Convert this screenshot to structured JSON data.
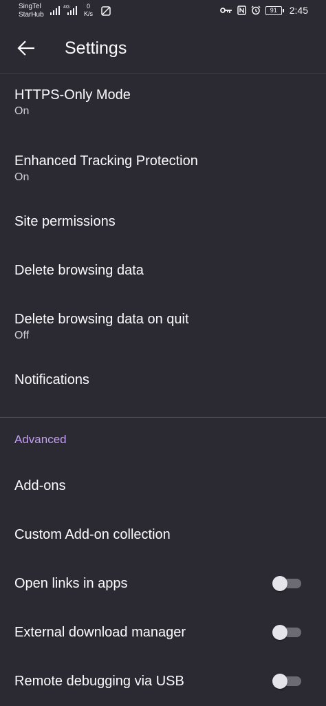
{
  "status_bar": {
    "carrier_1": "SingTel",
    "carrier_2": "StarHub",
    "network_type": "4G",
    "speed_value": "0",
    "speed_unit": "K/s",
    "battery": "91",
    "time": "2:45"
  },
  "app_bar": {
    "title": "Settings",
    "back_icon": "arrow-left-icon"
  },
  "settings": {
    "https_only": {
      "title": "HTTPS-Only Mode",
      "summary": "On"
    },
    "tracking_protection": {
      "title": "Enhanced Tracking Protection",
      "summary": "On"
    },
    "site_permissions": {
      "title": "Site permissions"
    },
    "delete_browsing_data": {
      "title": "Delete browsing data"
    },
    "delete_on_quit": {
      "title": "Delete browsing data on quit",
      "summary": "Off"
    },
    "notifications": {
      "title": "Notifications"
    }
  },
  "advanced": {
    "header": "Advanced",
    "addons": {
      "title": "Add-ons"
    },
    "custom_addon_collection": {
      "title": "Custom Add-on collection"
    },
    "open_links_in_apps": {
      "title": "Open links in apps",
      "enabled": false
    },
    "external_download_manager": {
      "title": "External download manager",
      "enabled": false
    },
    "remote_debugging": {
      "title": "Remote debugging via USB",
      "enabled": false
    }
  },
  "colors": {
    "background": "#2b2a33",
    "text_primary": "#fbfbfe",
    "text_secondary": "#cfcfd8",
    "accent": "#c29ef6",
    "divider": "#52525e"
  }
}
